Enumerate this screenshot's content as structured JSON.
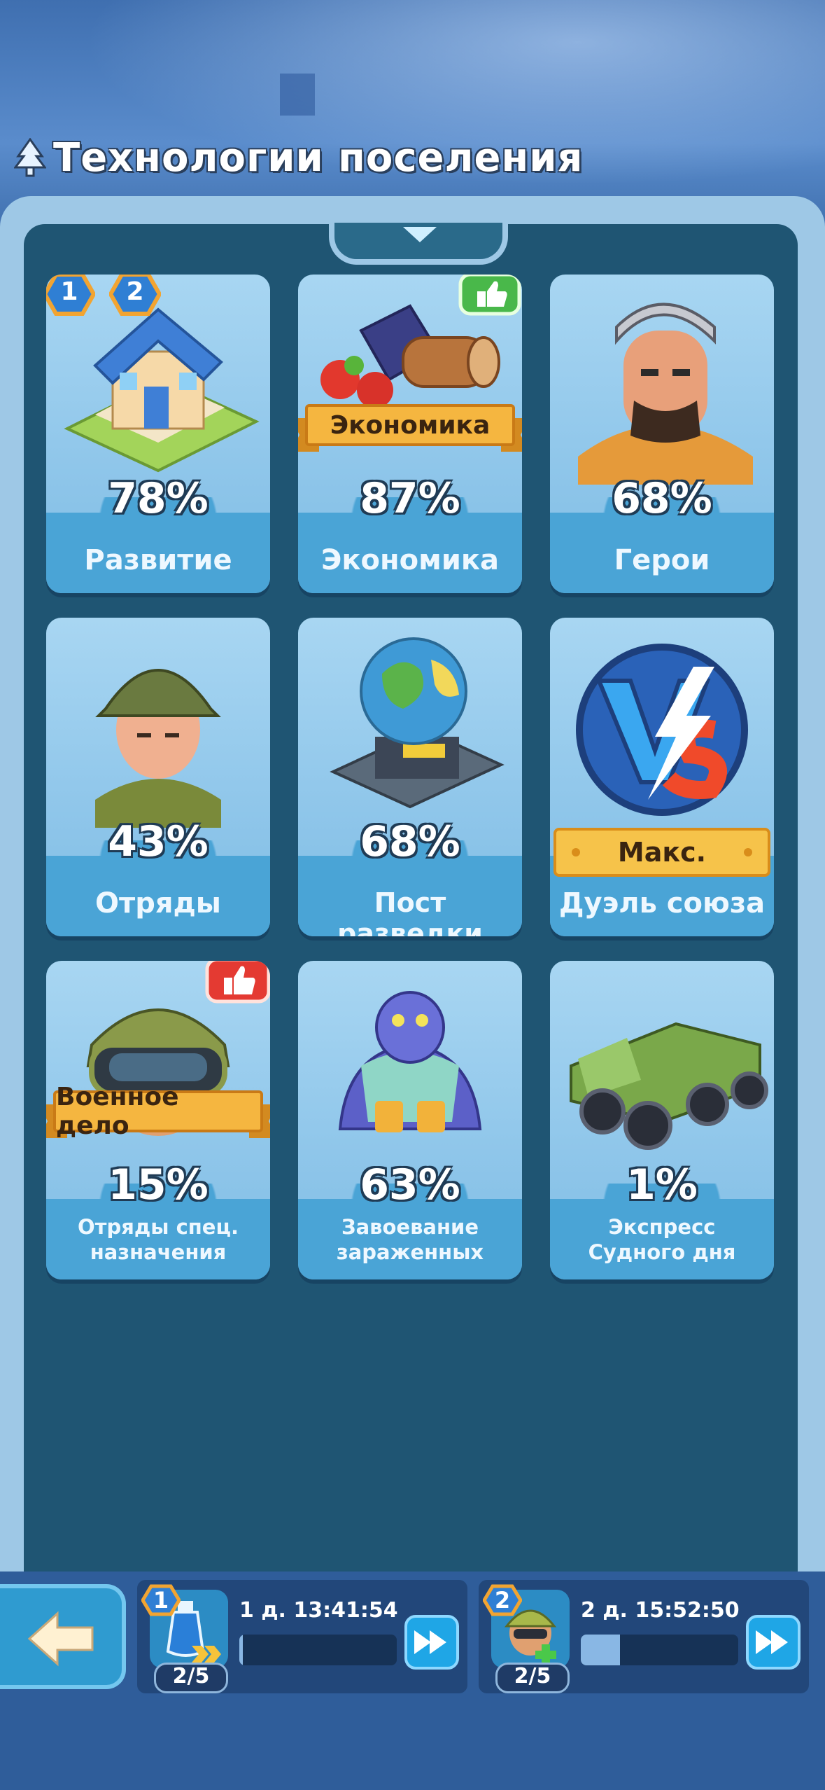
{
  "header": {
    "title": "Технологии поселения"
  },
  "cards": [
    {
      "percent": "78%",
      "name": "Развитие",
      "badges": [
        "1",
        "2"
      ]
    },
    {
      "percent": "87%",
      "name": "Экономика",
      "ribbon": "Экономика",
      "recommended": true
    },
    {
      "percent": "68%",
      "name": "Герои"
    },
    {
      "percent": "43%",
      "name": "Отряды"
    },
    {
      "percent": "68%",
      "name": "Пост разведки"
    },
    {
      "percent": "",
      "name": "Дуэль союза",
      "max_label": "Макс."
    },
    {
      "percent": "15%",
      "name": "Отряды спец. назначения",
      "ribbon": "Военное дело",
      "recommended": true
    },
    {
      "percent": "63%",
      "name": "Завоевание зараженных"
    },
    {
      "percent": "1%",
      "name": "Экспресс Судного дня"
    }
  ],
  "queues": [
    {
      "index": "1",
      "timer": "1 д. 13:41:54",
      "count": "2/5",
      "progress": 0.01
    },
    {
      "index": "2",
      "timer": "2 д. 15:52:50",
      "count": "2/5",
      "progress": 0.25
    }
  ],
  "colors": {
    "panel": "#9ec8e6",
    "inner": "#1f5573",
    "card": "#8fc6ea",
    "ribbon": "#f5b640",
    "accent_blue": "#1fa6e6"
  }
}
